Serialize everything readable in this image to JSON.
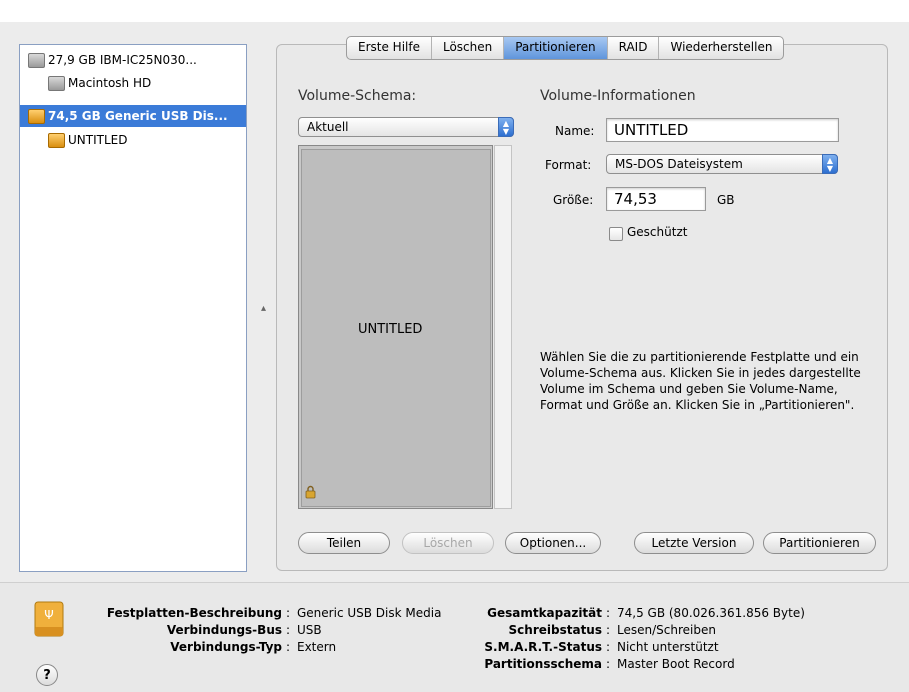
{
  "sidebar": {
    "items": [
      {
        "label": "27,9 GB IBM-IC25N030...",
        "icon": "hard-disk-icon"
      },
      {
        "label": "Macintosh HD",
        "icon": "volume-icon"
      },
      {
        "label": "74,5 GB Generic USB Dis...",
        "icon": "usb-disk-icon",
        "selected": true
      },
      {
        "label": "UNTITLED",
        "icon": "usb-volume-icon"
      }
    ]
  },
  "tabs": [
    {
      "label": "Erste Hilfe"
    },
    {
      "label": "Löschen"
    },
    {
      "label": "Partitionieren",
      "active": true
    },
    {
      "label": "RAID"
    },
    {
      "label": "Wiederherstellen"
    }
  ],
  "scheme": {
    "heading": "Volume-Schema:",
    "popup_value": "Aktuell",
    "volume_label": "UNTITLED"
  },
  "info": {
    "heading": "Volume-Informationen",
    "name_label": "Name:",
    "name_value": "UNTITLED",
    "format_label": "Format:",
    "format_value": "MS-DOS Dateisystem",
    "size_label": "Größe:",
    "size_value": "74,53",
    "size_unit": "GB",
    "protected_label": "Geschützt",
    "protected_checked": false
  },
  "help_text": "Wählen Sie die zu partitionierende Festplatte und ein Volume-Schema aus. Klicken Sie in jedes dargestellte Volume im Schema und geben Sie Volume-Name, Format und Größe an. Klicken Sie in „Partitionieren\".",
  "buttons": {
    "split": "Teilen",
    "delete": "Löschen",
    "options": "Optionen...",
    "revert": "Letzte Version",
    "partition": "Partitionieren"
  },
  "disk_info": {
    "left": [
      {
        "key": "Festplatten-Beschreibung",
        "value": "Generic USB Disk Media"
      },
      {
        "key": "Verbindungs-Bus",
        "value": "USB"
      },
      {
        "key": "Verbindungs-Typ",
        "value": "Extern"
      }
    ],
    "right": [
      {
        "key": "Gesamtkapazität",
        "value": "74,5 GB (80.026.361.856 Byte)"
      },
      {
        "key": "Schreibstatus",
        "value": "Lesen/Schreiben"
      },
      {
        "key": "S.M.A.R.T.-Status",
        "value": "Nicht unterstützt"
      },
      {
        "key": "Partitionsschema",
        "value": "Master Boot Record"
      }
    ],
    "separator": ":"
  },
  "help_button": "?",
  "colors": {
    "selection": "#3b7bd8",
    "accent": "#2d6fd0"
  }
}
